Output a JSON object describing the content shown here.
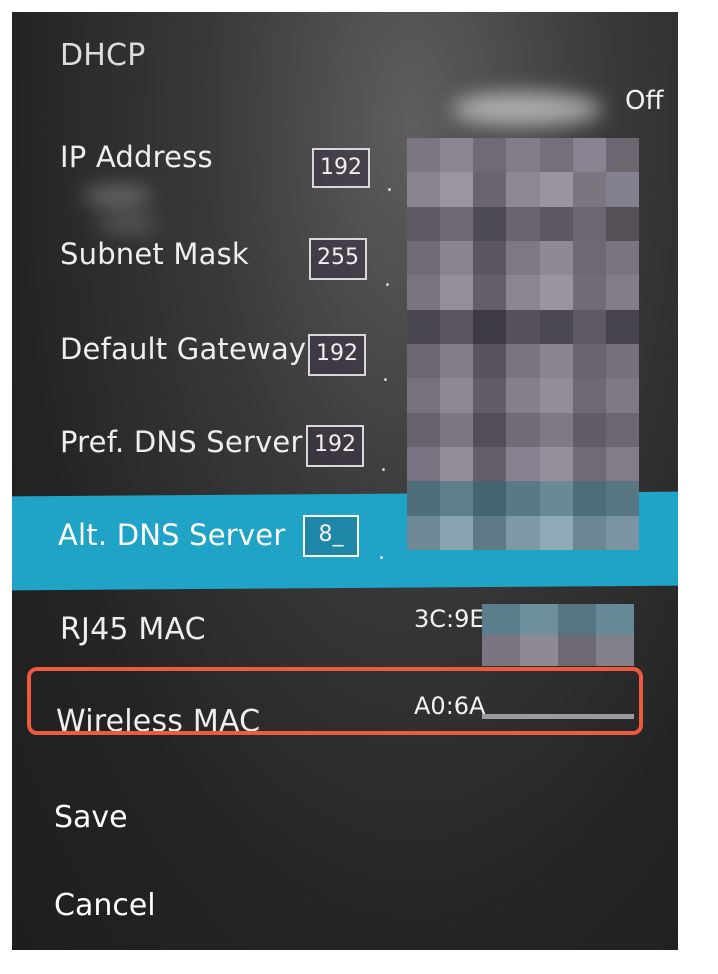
{
  "settings": {
    "dhcp": {
      "label": "DHCP",
      "value": "Off"
    },
    "ip_address": {
      "label": "IP Address",
      "first_octet": "192",
      "separator": "."
    },
    "subnet_mask": {
      "label": "Subnet Mask",
      "first_octet": "255",
      "separator": "."
    },
    "default_gateway": {
      "label": "Default Gateway",
      "first_octet": "192",
      "separator": "."
    },
    "pref_dns": {
      "label": "Pref. DNS Server",
      "first_octet": "192",
      "separator": "."
    },
    "alt_dns": {
      "label": "Alt. DNS Server",
      "first_octet": "8_",
      "separator": ".",
      "selected": true
    },
    "rj45_mac": {
      "label": "RJ45 MAC",
      "value": "3C:9E"
    },
    "wireless_mac": {
      "label": "Wireless MAC",
      "value": "A0:6A"
    }
  },
  "actions": {
    "save": "Save",
    "cancel": "Cancel"
  },
  "colors": {
    "highlight": "#1fa3c6",
    "callout": "#ee5a3e",
    "background": "#2b2b2b"
  }
}
